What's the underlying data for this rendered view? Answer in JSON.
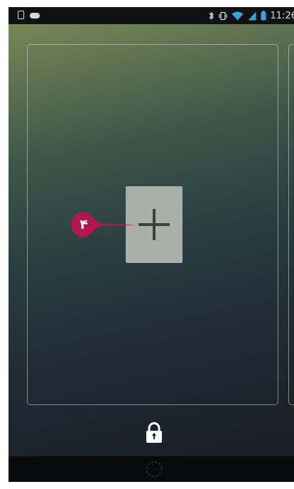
{
  "status_bar": {
    "time": "11:26",
    "left_icons": [
      "phone-icon",
      "cloud-icon"
    ],
    "right_icons": [
      "bluetooth-icon",
      "vibrate-icon",
      "wifi-icon",
      "signal-icon",
      "battery-icon"
    ]
  },
  "widget_area": {
    "add_button_icon": "plus-icon",
    "callout_number": "۴",
    "callout_color": "#b3164a"
  },
  "lockscreen": {
    "lock_icon": "lock-icon"
  },
  "nav_bar": {
    "home_icon": "home-ring-icon"
  }
}
